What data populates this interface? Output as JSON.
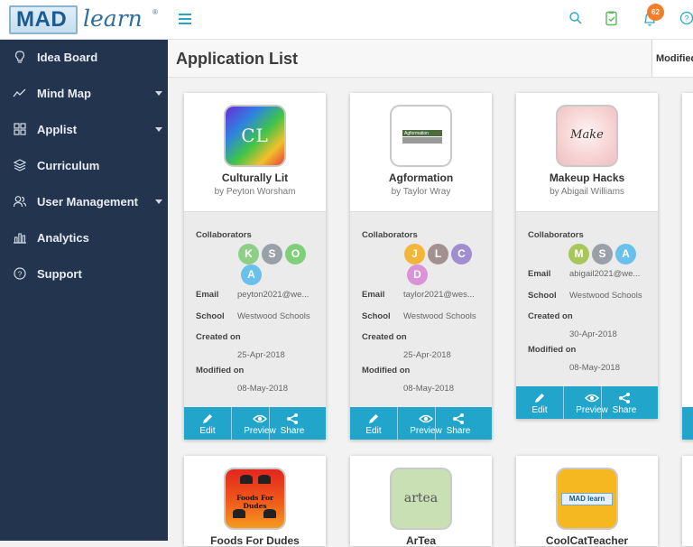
{
  "logo": {
    "mad": "MAD",
    "learn": "learn",
    "reg": "®"
  },
  "topbar": {
    "notifications_count": "62"
  },
  "sidebar": {
    "items": [
      {
        "label": "Idea Board",
        "icon": "lightbulb-icon",
        "has_caret": false
      },
      {
        "label": "Mind Map",
        "icon": "trend-icon",
        "has_caret": true
      },
      {
        "label": "Applist",
        "icon": "grid-icon",
        "has_caret": true
      },
      {
        "label": "Curriculum",
        "icon": "layers-icon",
        "has_caret": false
      },
      {
        "label": "User Management",
        "icon": "users-icon",
        "has_caret": true
      },
      {
        "label": "Analytics",
        "icon": "bar-chart-icon",
        "has_caret": false
      },
      {
        "label": "Support",
        "icon": "help-circle-icon",
        "has_caret": false
      }
    ]
  },
  "header": {
    "title": "Application List",
    "sort_label": "Modified"
  },
  "labels": {
    "collaborators": "Collaborators",
    "email": "Email",
    "school": "School",
    "created_on": "Created on",
    "modified_on": "Modified on",
    "edit": "Edit",
    "preview": "Preview",
    "share": "Share"
  },
  "cards": [
    {
      "name": "Culturally Lit",
      "by": "by Peyton Worsham",
      "icon_text": "CL",
      "collaborators": [
        {
          "initial": "K",
          "color": "#8dcf86"
        },
        {
          "initial": "S",
          "color": "#9aa0a8"
        },
        {
          "initial": "O",
          "color": "#7fcf7b"
        },
        {
          "initial": "A",
          "color": "#69c0ea"
        }
      ],
      "email": "peyton2021@we...",
      "school": "Westwood Schools",
      "created_on": "25-Apr-2018",
      "modified_on": "08-May-2018"
    },
    {
      "name": "Agformation",
      "by": "by Taylor Wray",
      "icon_text": "Agformation",
      "collaborators": [
        {
          "initial": "J",
          "color": "#f3b63a"
        },
        {
          "initial": "L",
          "color": "#a39191"
        },
        {
          "initial": "C",
          "color": "#9f8fd0"
        },
        {
          "initial": "D",
          "color": "#d993d6"
        }
      ],
      "email": "taylor2021@wes...",
      "school": "Westwood Schools",
      "created_on": "25-Apr-2018",
      "modified_on": "08-May-2018"
    },
    {
      "name": "Makeup Hacks",
      "by": "by Abigail Williams",
      "icon_text": "Make",
      "collaborators": [
        {
          "initial": "M",
          "color": "#a7c75a"
        },
        {
          "initial": "S",
          "color": "#9aa0a8"
        },
        {
          "initial": "A",
          "color": "#69c0ea"
        }
      ],
      "email": "abigail2021@we...",
      "school": "Westwood Schools",
      "created_on": "30-Apr-2018",
      "modified_on": "08-May-2018"
    }
  ],
  "cards_row2": [
    {
      "name": "Foods For Dudes",
      "icon_text": "Foods For Dudes"
    },
    {
      "name": "ArTea",
      "icon_text": "artea"
    },
    {
      "name": "CoolCatTeacher",
      "icon_text": "MAD learn"
    }
  ]
}
